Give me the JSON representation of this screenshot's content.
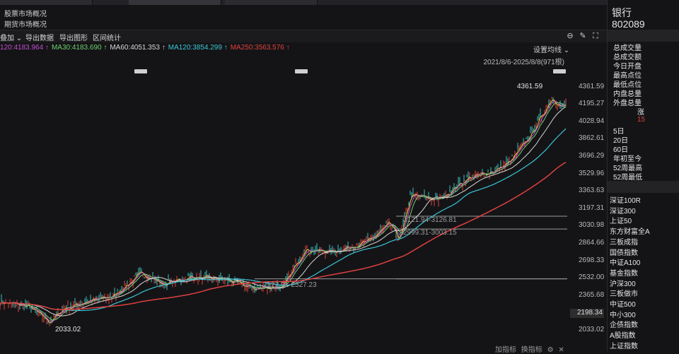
{
  "nav": {
    "items": [
      "股票市场概况",
      "期货市场概况"
    ]
  },
  "toolbar": {
    "overlay_label": "叠加",
    "export_data_label": "导出数据",
    "export_chart_label": "导出图形",
    "range_stats_label": "区间统计"
  },
  "chart_header": {
    "ma": [
      {
        "text": "120:4183.964",
        "color": "#c04fd0"
      },
      {
        "text": "MA30:4183.690",
        "color": "#6fd06f"
      },
      {
        "text": "MA60:4051.353",
        "color": "#d8d8d8"
      },
      {
        "text": "MA120:3854.299",
        "color": "#3cc6d8"
      },
      {
        "text": "MA250:3563.576",
        "color": "#e04040"
      }
    ],
    "range": "2021/8/6-2025/8/8(971根)",
    "setting": "设置均线"
  },
  "chart_data": {
    "type": "line",
    "y_ticks": [
      "4361.59",
      "4195.27",
      "4028.94",
      "3862.61",
      "3696.29",
      "3529.96",
      "3363.63",
      "3197.31",
      "3030.98",
      "2864.66",
      "2698.33",
      "2532.00",
      "2365.68",
      "2198.34",
      "2033.02"
    ],
    "ylim": [
      2000,
      4420
    ],
    "current_value": "2198.34",
    "max_label": "4361.59",
    "min_label": "2033.02",
    "annotations": [
      "3121.94-3126.81",
      "2999.31-3003.15",
      "2522.91-2527.23"
    ],
    "levels": [
      3121.94,
      2999.31,
      2522.91
    ]
  },
  "footer": {
    "items": [
      "加指标",
      "换指标"
    ]
  },
  "quote": {
    "name": "银行",
    "code": "802089",
    "stats": [
      "总成交量",
      "总成交额",
      "今日开盘",
      "最高点位",
      "最低点位",
      "内盘总量",
      "外盘总量"
    ],
    "zhang": "涨",
    "zhang_value": "15",
    "periods": [
      "5日",
      "20日",
      "60日",
      "年初至今",
      "52周最高",
      "52周最低"
    ],
    "indexes": [
      "深证100R",
      "深证300",
      "上证50",
      "东方财富全A",
      "三板成指",
      "国债指数",
      "中证A100",
      "基金指数",
      "沪深300",
      "三板做市",
      "中证500",
      "中小300",
      "企债指数",
      "A股指数",
      "上证指数"
    ]
  },
  "colors": {
    "up": "#e04040",
    "ma5": "#ffffff",
    "ma10": "#e8d040",
    "ma20": "#c04fd0",
    "ma30": "#6fd06f",
    "ma60": "#d8d8d8",
    "ma120": "#3cc6d8",
    "ma250": "#e04040"
  }
}
